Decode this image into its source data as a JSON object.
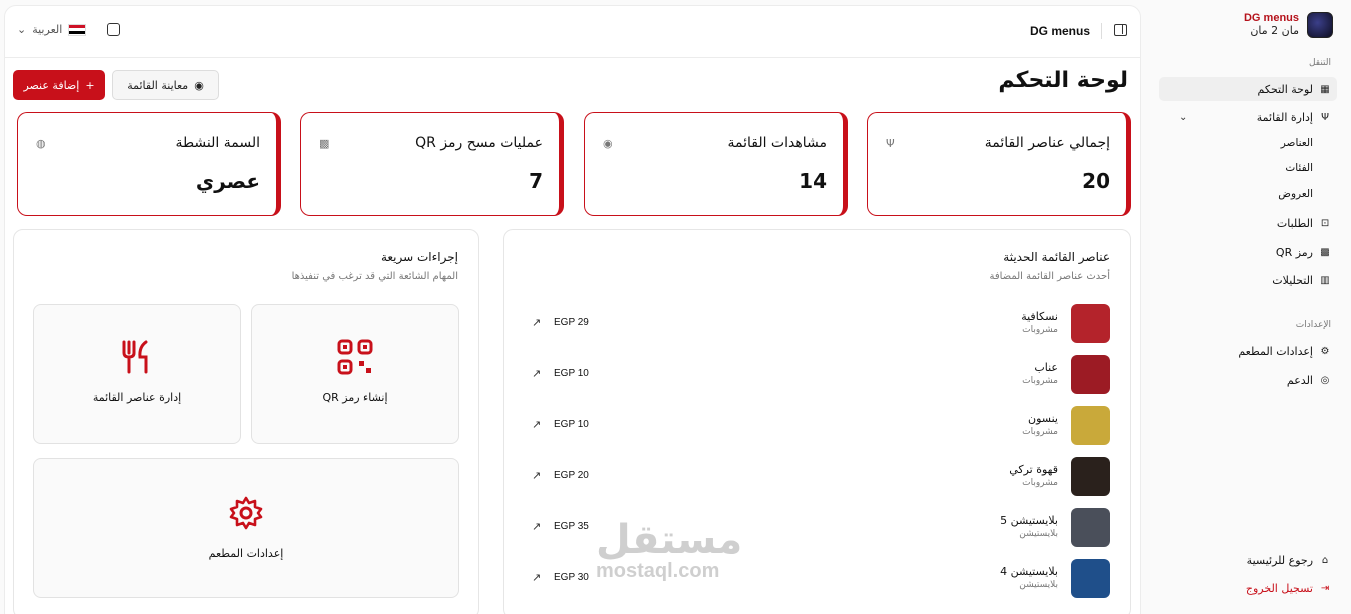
{
  "brand": {
    "name": "DG menus",
    "subtitle": "مان 2 مان"
  },
  "sidebar": {
    "section_nav": "التنقل",
    "items": [
      {
        "label": "لوحة التحكم",
        "icon": "grid-icon"
      },
      {
        "label": "إدارة القائمة",
        "icon": "utensils-icon"
      },
      {
        "label": "الطلبات",
        "icon": "bag-icon"
      },
      {
        "label": "رمز QR",
        "icon": "qr-icon"
      },
      {
        "label": "التحليلات",
        "icon": "chart-icon"
      }
    ],
    "submenu": [
      "العناصر",
      "الفئات",
      "العروض"
    ],
    "section_settings": "الإعدادات",
    "settings_items": [
      {
        "label": "إعدادات المطعم",
        "icon": "gear-icon"
      },
      {
        "label": "الدعم",
        "icon": "lifebuoy-icon"
      }
    ],
    "home": "رجوع للرئيسية",
    "logout": "تسجيل الخروج"
  },
  "topbar": {
    "title": "DG menus",
    "language": "العربية"
  },
  "page": {
    "title": "لوحة التحكم",
    "add_button": "إضافة عنصر",
    "preview_button": "معاينة القائمة"
  },
  "stats": [
    {
      "title": "إجمالي عناصر القائمة",
      "value": "20",
      "icon": "utensils-icon"
    },
    {
      "title": "مشاهدات القائمة",
      "value": "14",
      "icon": "eye-icon"
    },
    {
      "title": "عمليات مسح رمز QR",
      "value": "7",
      "icon": "qr-icon"
    },
    {
      "title": "السمة النشطة",
      "value": "عصري",
      "icon": "palette-icon"
    }
  ],
  "recent": {
    "title": "عناصر القائمة الحديثة",
    "subtitle": "أحدث عناصر القائمة المضافة",
    "items": [
      {
        "name": "نسكافية",
        "category": "مشروبات",
        "price": "EGP 29",
        "color": "#b4232b"
      },
      {
        "name": "عناب",
        "category": "مشروبات",
        "price": "EGP 10",
        "color": "#9c1b24"
      },
      {
        "name": "ينسون",
        "category": "مشروبات",
        "price": "EGP 10",
        "color": "#c9a93a"
      },
      {
        "name": "قهوة تركي",
        "category": "مشروبات",
        "price": "EGP 20",
        "color": "#2a211c"
      },
      {
        "name": "بلايستيشن 5",
        "category": "بلايستيشن",
        "price": "EGP 35",
        "color": "#4a4f5a"
      },
      {
        "name": "بلايستيشن 4",
        "category": "بلايستيشن",
        "price": "EGP 30",
        "color": "#1f4f8a"
      }
    ]
  },
  "quick": {
    "title": "إجراءات سريعة",
    "subtitle": "المهام الشائعة التي قد ترغب في تنفيذها",
    "actions": [
      {
        "label": "إنشاء رمز QR",
        "icon": "qr-icon"
      },
      {
        "label": "إدارة عناصر القائمة",
        "icon": "utensils-icon"
      },
      {
        "label": "إعدادات المطعم",
        "icon": "gear-icon"
      }
    ]
  },
  "watermark": {
    "arabic": "مستقل",
    "latin": "mostaql.com"
  },
  "colors": {
    "accent": "#c8101a"
  }
}
